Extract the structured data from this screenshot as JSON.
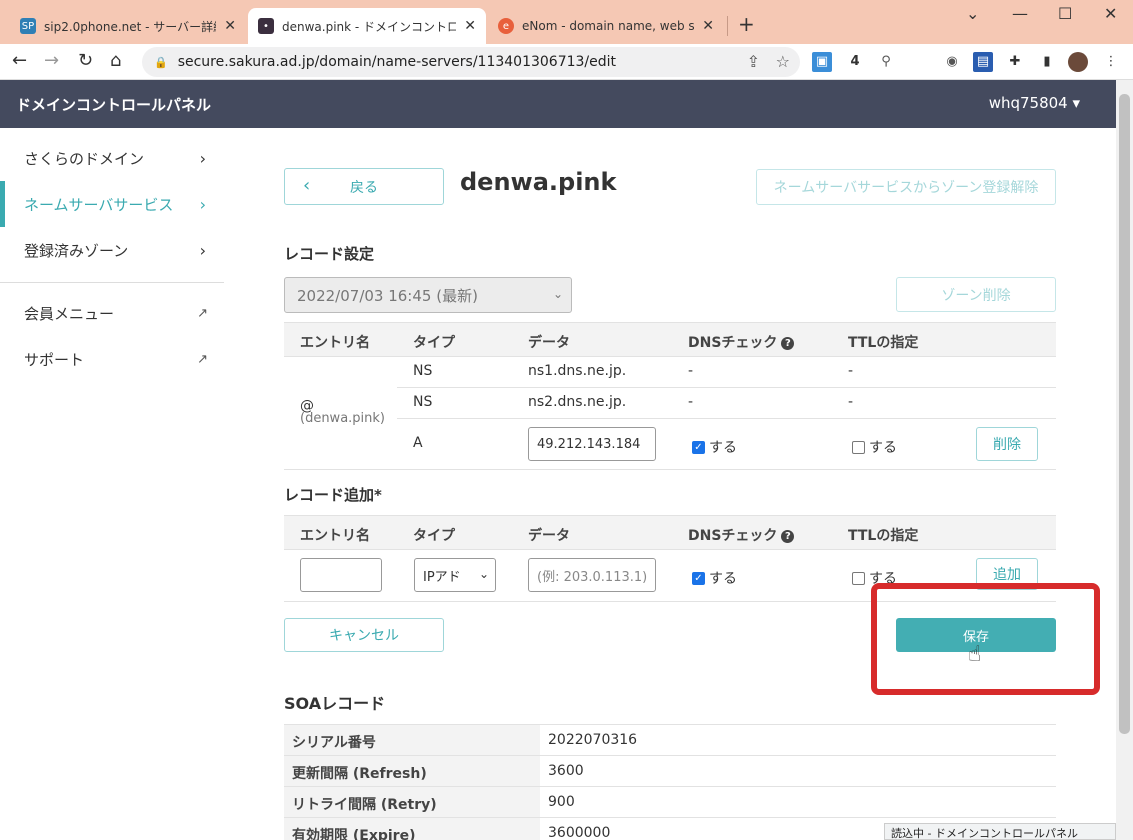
{
  "browser": {
    "tabs": [
      {
        "title": "sip2.0phone.net - サーバー詳細 - さ",
        "favicon": "SP",
        "color": "#2f7fb5"
      },
      {
        "title": "denwa.pink - ドメインコントロールパネ",
        "favicon": "•",
        "color": "#3b2f3f"
      },
      {
        "title": "eNom - domain name, web site h",
        "favicon": "e",
        "color": "#e8603c"
      }
    ],
    "url": "secure.sakura.ad.jp/domain/name-servers/113401306713/edit",
    "status": "読込中 - ドメインコントロールパネル"
  },
  "app": {
    "brand": "ドメインコントロールパネル",
    "user": "whq75804 ▾"
  },
  "sidebar": {
    "items": [
      {
        "label": "さくらのドメイン",
        "icon": "chevron-right-icon"
      },
      {
        "label": "ネームサーバサービス",
        "icon": "chevron-right-icon",
        "active": true
      },
      {
        "label": "登録済みゾーン",
        "icon": "chevron-right-icon"
      },
      {
        "label": "会員メニュー",
        "icon": "external-link-icon"
      },
      {
        "label": "サポート",
        "icon": "external-link-icon"
      }
    ]
  },
  "main": {
    "back_label": "戻る",
    "domain_title": "denwa.pink",
    "unregister_label": "ネームサーバサービスからゾーン登録解除",
    "record_settings_heading": "レコード設定",
    "zone_version": "2022/07/03 16:45 (最新)",
    "zone_delete_label": "ゾーン削除",
    "columns": [
      "エントリ名",
      "タイプ",
      "データ",
      "DNSチェック",
      "TTLの指定"
    ],
    "entry_name": "@",
    "entry_sub": "(denwa.pink)",
    "records": [
      {
        "type": "NS",
        "data": "ns1.dns.ne.jp.",
        "dns": "-",
        "ttl": "-"
      },
      {
        "type": "NS",
        "data": "ns2.dns.ne.jp.",
        "dns": "-",
        "ttl": "-"
      },
      {
        "type": "A",
        "data": "49.212.143.184",
        "dns_label": "する",
        "ttl_label": "する",
        "delete_label": "削除"
      }
    ],
    "add_heading": "レコード追加*",
    "add_row": {
      "entry_value": "",
      "type_value": "IPアド",
      "data_placeholder": "(例: 203.0.113.1)",
      "dns_label": "する",
      "ttl_label": "する",
      "add_label": "追加"
    },
    "cancel_label": "キャンセル",
    "save_label": "保存",
    "soa_heading": "SOAレコード",
    "soa": [
      {
        "key": "シリアル番号",
        "value": "2022070316"
      },
      {
        "key": "更新間隔 (Refresh)",
        "value": "3600"
      },
      {
        "key": "リトライ間隔 (Retry)",
        "value": "900"
      },
      {
        "key": "有効期限 (Expire)",
        "value": "3600000"
      }
    ]
  }
}
